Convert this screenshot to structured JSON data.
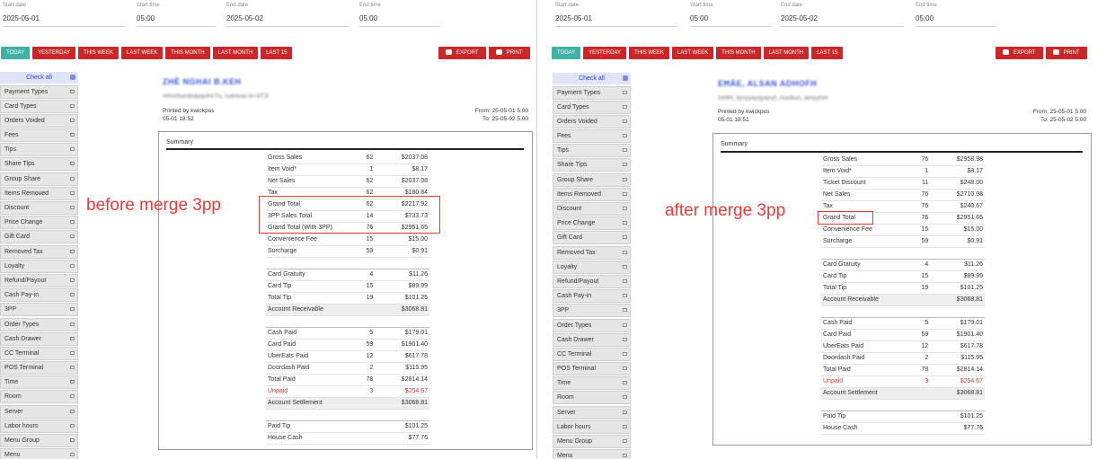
{
  "left": {
    "dates": {
      "start_date_label": "Start date",
      "start_date": "2025-05-01",
      "start_time_label": "Start time",
      "start_time": "05:00",
      "end_date_label": "End date",
      "end_date": "2025-05-02",
      "end_time_label": "End time",
      "end_time": "05:00"
    },
    "filters": [
      "TODAY",
      "YESTERDAY",
      "THIS WEEK",
      "LAST WEEK",
      "THIS MONTH",
      "LAST MONTH",
      "LAST 15"
    ],
    "export_label": "EXPORT",
    "print_label": "PRINT",
    "check_all": "Check all",
    "sidebar": [
      "Payment Types",
      "Card Types",
      "Orders Voided",
      "Fees",
      "Tips",
      "Share Tips",
      "Group Share",
      "Items Removed",
      "Discount",
      "Price Change",
      "Gift Card",
      "Removed Tax",
      "Loyalty",
      "Refund/Payout",
      "Cash Pay-in",
      "3PP",
      "Order Types",
      "Cash Drawer",
      "CC Terminal",
      "POS Terminal",
      "Time",
      "Room",
      "Server",
      "Labor hours",
      "Menu Group",
      "Menu"
    ],
    "report": {
      "title": "ZHĒ NGHAI B.KEH",
      "subtitle": "mhnrhundrayquhV7u, ruemua ni+4TJI",
      "printed_by": "Printed by kwickpos",
      "printed_at": "05-01 18:52",
      "from": "From: 25-05-01 5:00",
      "to": "To: 25-05-02 5:00"
    },
    "summary_title": "Summary",
    "rows": [
      {
        "label": "Gross Sales",
        "count": "62",
        "amount": "$2037.08"
      },
      {
        "label": "Item Void*",
        "count": "1",
        "amount": "$8.17"
      },
      {
        "label": "Net Sales",
        "count": "62",
        "amount": "$2037.08"
      },
      {
        "label": "Tax",
        "count": "62",
        "amount": "$180.84"
      },
      {
        "label": "Grand Total",
        "count": "62",
        "amount": "$2217.92"
      },
      {
        "label": "3PP Sales Total",
        "count": "14",
        "amount": "$733.73"
      },
      {
        "label": "Grand Total (With 3PP)",
        "count": "76",
        "amount": "$2951.65"
      },
      {
        "label": "Convenience Fee",
        "count": "15",
        "amount": "$15.00"
      },
      {
        "label": "Surcharge",
        "count": "59",
        "amount": "$0.91"
      },
      {
        "label": "",
        "count": "",
        "amount": "",
        "blank": true
      },
      {
        "label": "Card Gratuity",
        "count": "4",
        "amount": "$11.26"
      },
      {
        "label": "Card Tip",
        "count": "15",
        "amount": "$89.99"
      },
      {
        "label": "Total Tip",
        "count": "19",
        "amount": "$101.25"
      },
      {
        "label": "Account Receivable",
        "count": "",
        "amount": "$3068.81",
        "hl": true
      },
      {
        "label": "",
        "count": "",
        "amount": "",
        "blank": true
      },
      {
        "label": "Cash Paid",
        "count": "5",
        "amount": "$179.01"
      },
      {
        "label": "Card Paid",
        "count": "59",
        "amount": "$1901.40"
      },
      {
        "label": "UberEats Paid",
        "count": "12",
        "amount": "$617.78"
      },
      {
        "label": "Doordash Paid",
        "count": "2",
        "amount": "$115.95"
      },
      {
        "label": "Total Paid",
        "count": "78",
        "amount": "$2814.14"
      },
      {
        "label": "Unpaid",
        "count": "3",
        "amount": "$254.67",
        "red": true
      },
      {
        "label": "Account Settlement",
        "count": "",
        "amount": "$3068.81",
        "hl": true
      },
      {
        "label": "",
        "count": "",
        "amount": "",
        "blank": true
      },
      {
        "label": "Paid Tip",
        "count": "",
        "amount": "$101.25"
      },
      {
        "label": "House Cash",
        "count": "",
        "amount": "$77.76"
      }
    ],
    "note": "before merge 3pp"
  },
  "right": {
    "dates": {
      "start_date_label": "Start date",
      "start_date": "2025-05-01",
      "start_time_label": "Start time",
      "start_time": "05:00",
      "end_date_label": "End date",
      "end_date": "2025-05-02",
      "end_time_label": "End time",
      "end_time": "05:00"
    },
    "filters": [
      "TODAY",
      "YESTERDAY",
      "THIS WEEK",
      "LAST WEEK",
      "THIS MONTH",
      "LAST MONTH",
      "LAST 15"
    ],
    "export_label": "EXPORT",
    "print_label": "PRINT",
    "check_all": "Check all",
    "sidebar": [
      "Payment Types",
      "Card Types",
      "Orders Voided",
      "Fees",
      "Tips",
      "Share Tips",
      "Group Share",
      "Items Removed",
      "Discount",
      "Price Change",
      "Gift Card",
      "Removed Tax",
      "Loyalty",
      "Refund/Payout",
      "Cash Pay-in",
      "3PP",
      "Order Types",
      "Cash Drawer",
      "CC Terminal",
      "POS Terminal",
      "Time",
      "Room",
      "Server",
      "Labor hours",
      "Menu Group",
      "Menu"
    ],
    "report": {
      "title": "EĦĀE, ALSAN ADHOFH",
      "subtitle": "mhfH, bjnyyayqyqnyt, nuuhun, amyyhm",
      "printed_by": "Printed by kwickpos",
      "printed_at": "05-01 18:51",
      "from": "From: 25-05-01 5:00",
      "to": "To: 25-05-02 5:00"
    },
    "summary_title": "Summary",
    "rows": [
      {
        "label": "Gross Sales",
        "count": "76",
        "amount": "$2958.98"
      },
      {
        "label": "Item Void*",
        "count": "1",
        "amount": "$8.17"
      },
      {
        "label": "Ticket Discount",
        "count": "11",
        "amount": "$248.00"
      },
      {
        "label": "Net Sales",
        "count": "76",
        "amount": "$2710.98"
      },
      {
        "label": "Tax",
        "count": "76",
        "amount": "$240.67"
      },
      {
        "label": "Grand Total",
        "count": "76",
        "amount": "$2951.65"
      },
      {
        "label": "Convenience Fee",
        "count": "15",
        "amount": "$15.00"
      },
      {
        "label": "Surcharge",
        "count": "59",
        "amount": "$0.91"
      },
      {
        "label": "",
        "count": "",
        "amount": "",
        "blank": true
      },
      {
        "label": "Card Gratuity",
        "count": "4",
        "amount": "$11.26"
      },
      {
        "label": "Card Tip",
        "count": "15",
        "amount": "$89.99"
      },
      {
        "label": "Total Tip",
        "count": "19",
        "amount": "$101.25"
      },
      {
        "label": "Account Receivable",
        "count": "",
        "amount": "$3068.81",
        "hl": true
      },
      {
        "label": "",
        "count": "",
        "amount": "",
        "blank": true
      },
      {
        "label": "Cash Paid",
        "count": "5",
        "amount": "$179.01"
      },
      {
        "label": "Card Paid",
        "count": "59",
        "amount": "$1901.40"
      },
      {
        "label": "UberEats Paid",
        "count": "12",
        "amount": "$617.78"
      },
      {
        "label": "Doordash Paid",
        "count": "2",
        "amount": "$115.95"
      },
      {
        "label": "Total Paid",
        "count": "78",
        "amount": "$2814.14"
      },
      {
        "label": "Unpaid",
        "count": "3",
        "amount": "$254.67",
        "red": true
      },
      {
        "label": "Account Settlement",
        "count": "",
        "amount": "$3068.81",
        "hl": true
      },
      {
        "label": "",
        "count": "",
        "amount": "",
        "blank": true
      },
      {
        "label": "Paid Tip",
        "count": "",
        "amount": "$101.25"
      },
      {
        "label": "House Cash",
        "count": "",
        "amount": "$77.76"
      }
    ],
    "note": "after merge 3pp"
  },
  "colors": {
    "active_filter": "#3fb1a5",
    "filter_button": "#c8282a",
    "annotation": "#e53b3b",
    "unpaid": "#dd3333"
  }
}
